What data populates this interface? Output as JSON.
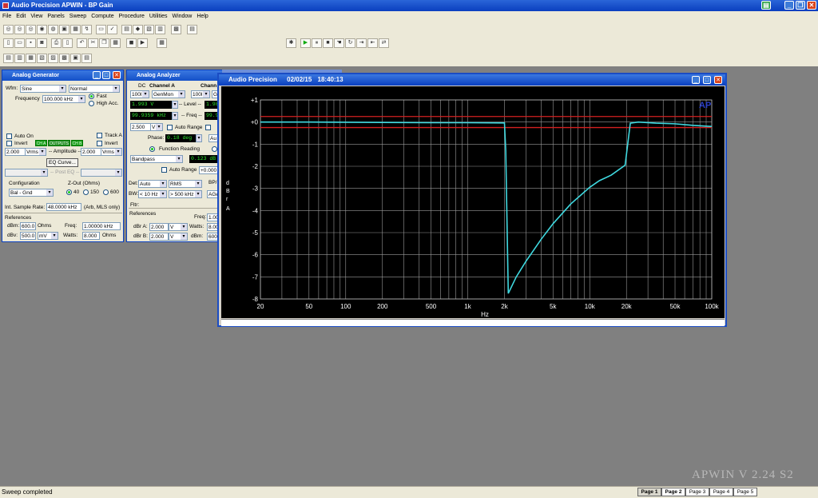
{
  "app": {
    "title": "Audio Precision APWIN - BP Gain"
  },
  "menu": [
    "File",
    "Edit",
    "View",
    "Panels",
    "Sweep",
    "Compute",
    "Procedure",
    "Utilities",
    "Window",
    "Help"
  ],
  "generator": {
    "title": "Analog Generator",
    "wfm_label": "Wfm:",
    "wfm_value": "Sine",
    "wfm_mode": "Normal",
    "freq_label": "Frequency",
    "freq_value": "100.000 kHz",
    "fast_label": "Fast",
    "highacc_label": "High Acc.",
    "auto_on_label": "Auto On",
    "invert_label": "Invert",
    "outputs_label": "OUTPUTS",
    "ch_a": "CH A",
    "ch_b": "CH B",
    "track_a_label": "Track A",
    "invert_b_label": "Invert",
    "amp_a": "2.000",
    "amp_a_unit": "Vrms",
    "amplitude_label": "-- Amplitude --",
    "amp_b": "2.000",
    "amp_b_unit": "Vrms",
    "eq_curve_label": "EQ Curve...",
    "post_eq_label": "-- Post EQ --",
    "config_label": "Configuration",
    "config_value": "Bal - Gnd",
    "zout_label": "Z-Out (Ohms)",
    "zout_40": "40",
    "zout_150": "150",
    "zout_600": "600",
    "sample_rate_label": "Int. Sample Rate:",
    "sample_rate_value": "48.0000 kHz",
    "arb_note": "(Arb, MLS only)",
    "refs_label": "References",
    "dbm_label": "dBm:",
    "dbm_value": "600.0",
    "dbm_unit": "Ohms",
    "freq_ref_label": "Freq:",
    "freq_ref_value": "1.00000 kHz",
    "dbv_label": "dBv:",
    "dbv_value": "500.0",
    "dbv_unit": "mV",
    "watts_label": "Watts:",
    "watts_value": "8.000",
    "watts_unit": "Ohms"
  },
  "analyzer": {
    "title": "Analog Analyzer",
    "dc_label": "DC",
    "ch_a_label": "Channel A",
    "ch_b_label": "Chann",
    "range_a": "100l",
    "genmon": "GenMon",
    "range_b": "100l",
    "genmon_b": "G",
    "level_a": "1.993  V",
    "level_label": "-- Level --",
    "level_b": "1.98",
    "freq_a": "99.9359 kHz",
    "freq_label": "-- Freq --",
    "freq_b": "99.90",
    "range_v": "2.500",
    "range_v_unit": "V",
    "auto_range_label": "Auto Range",
    "phase_label": "Phase:",
    "phase_value": "0.18  deg",
    "phase_mode": "Au",
    "func_reading_label": "Function Reading",
    "filter_value": "Bandpass",
    "func_value": "0.123  dB",
    "auto_range2_label": "Auto Range",
    "auto_range2_value": "+0.000",
    "det_label": "Det:",
    "det_value": "Auto",
    "rms_value": "RMS",
    "bp_label": "BP/",
    "bw_label": "BW:",
    "bw_low": "< 10 Hz",
    "bw_high": "> 500 kHz",
    "agen_value": "AGen",
    "fltr_label": "Fltr:",
    "refs_label": "References",
    "freq_ref_label": "Freq:",
    "freq_ref_value": "1.00",
    "dbra_label": "dBr A:",
    "dbra_value": "2.000",
    "dbra_unit": "V",
    "watts_label": "Watts:",
    "watts_value": "8.00",
    "dbrb_label": "dBr B:",
    "dbrb_value": "2.000",
    "dbrb_unit": "V",
    "dbm_label": "dBm:",
    "dbm_value": "600"
  },
  "graph_window": {
    "title": "Audio Precision",
    "date": "02/02/15",
    "time": "18:40:13",
    "logo": "AP"
  },
  "chart_data": {
    "type": "line",
    "xscale": "log",
    "xlabel": "Hz",
    "ylabel": "dBr A",
    "xlim": [
      20,
      100000
    ],
    "ylim": [
      -8,
      1
    ],
    "xticks": [
      20,
      50,
      100,
      200,
      500,
      1000,
      2000,
      5000,
      10000,
      20000,
      50000,
      100000
    ],
    "xtick_labels": [
      "20",
      "50",
      "100",
      "200",
      "500",
      "1k",
      "2k",
      "5k",
      "10k",
      "20k",
      "50k",
      "100k"
    ],
    "yticks": [
      1,
      0,
      -1,
      -2,
      -3,
      -4,
      -5,
      -6,
      -7,
      -8
    ],
    "ytick_labels": [
      "+1",
      "+0",
      "-1",
      "-2",
      "-3",
      "-4",
      "-5",
      "-6",
      "-7",
      "-8"
    ],
    "limit_lines": [
      0.25,
      -0.25
    ],
    "series": [
      {
        "color": "#3fd9e0",
        "x": [
          20,
          50,
          100,
          200,
          500,
          1000,
          2000,
          2050,
          2150,
          2500,
          3000,
          4000,
          5000,
          7000,
          10000,
          12000,
          15000,
          19500,
          21500,
          25000,
          35000,
          50000,
          70000,
          100000
        ],
        "y": [
          0.0,
          0.0,
          -0.01,
          -0.02,
          -0.03,
          -0.03,
          -0.04,
          -1.3,
          -7.75,
          -7.0,
          -6.3,
          -5.3,
          -4.6,
          -3.7,
          -2.95,
          -2.65,
          -2.4,
          -1.95,
          -0.05,
          0.0,
          -0.05,
          -0.08,
          -0.15,
          -0.2
        ]
      }
    ]
  },
  "status": {
    "text": "Sweep completed"
  },
  "pages": [
    "Page 1",
    "Page 2",
    "Page 3",
    "Page 4",
    "Page 5"
  ],
  "watermark": "APWIN V 2.24 S2"
}
